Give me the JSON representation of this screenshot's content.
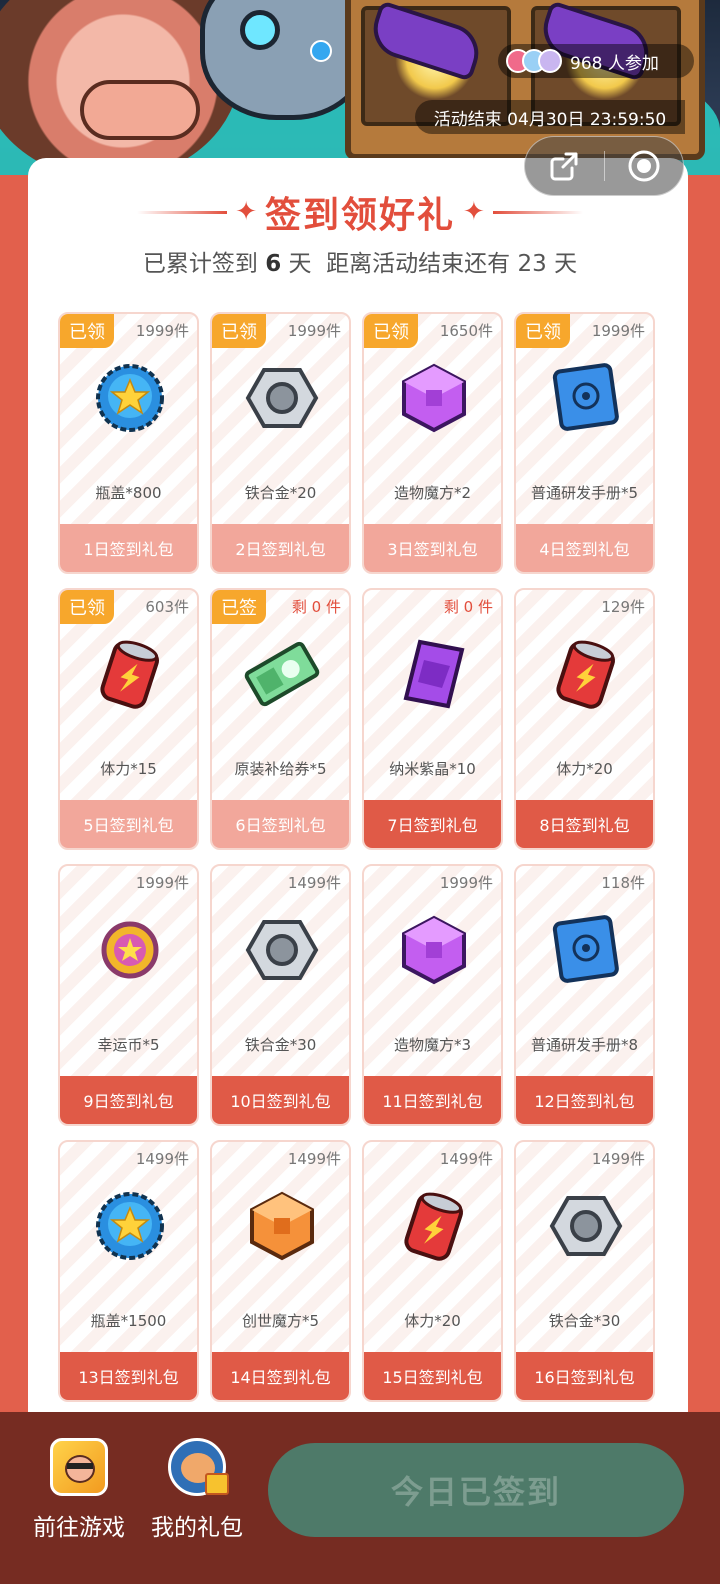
{
  "banner": {
    "participants_text": "968 人参加",
    "deadline_text": "活动结束 04月30日 23:59:50"
  },
  "header": {
    "title": "签到领好礼",
    "summary_prefix": "已累计签到",
    "signed_days": "6",
    "summary_mid": "天  距离活动结束还有",
    "remaining_days": "23",
    "summary_suffix": "天"
  },
  "colors": {
    "accent": "#e24e3c",
    "badge": "#f7a72c",
    "footer_active": "#e05a47",
    "footer_done": "#f2a79b",
    "bottom_bar": "#762c22",
    "sign_button": "#4e7a69"
  },
  "gifts": [
    {
      "badge": "已领",
      "stock": "1999件",
      "name": "瓶盖*800",
      "label": "1日签到礼包",
      "icon": "bottle-cap-icon",
      "done": true
    },
    {
      "badge": "已领",
      "stock": "1999件",
      "name": "铁合金*20",
      "label": "2日签到礼包",
      "icon": "hex-nut-icon",
      "done": true
    },
    {
      "badge": "已领",
      "stock": "1650件",
      "name": "造物魔方*2",
      "label": "3日签到礼包",
      "icon": "purple-cube-icon",
      "done": true
    },
    {
      "badge": "已领",
      "stock": "1999件",
      "name": "普通研发手册*5",
      "label": "4日签到礼包",
      "icon": "blue-book-icon",
      "done": true
    },
    {
      "badge": "已领",
      "stock": "603件",
      "name": "体力*15",
      "label": "5日签到礼包",
      "icon": "energy-can-icon",
      "done": true
    },
    {
      "badge": "已签",
      "stock": "剩 0 件",
      "name": "原装补给券*5",
      "label": "6日签到礼包",
      "icon": "ticket-icon",
      "done": true,
      "stock_red": true
    },
    {
      "badge": "",
      "stock": "剩 0 件",
      "name": "纳米紫晶*10",
      "label": "7日签到礼包",
      "icon": "purple-crystal-icon",
      "done": false,
      "stock_red": true
    },
    {
      "badge": "",
      "stock": "129件",
      "name": "体力*20",
      "label": "8日签到礼包",
      "icon": "energy-can-icon",
      "done": false
    },
    {
      "badge": "",
      "stock": "1999件",
      "name": "幸运币*5",
      "label": "9日签到礼包",
      "icon": "lucky-coin-icon",
      "done": false
    },
    {
      "badge": "",
      "stock": "1499件",
      "name": "铁合金*30",
      "label": "10日签到礼包",
      "icon": "hex-nut-icon",
      "done": false
    },
    {
      "badge": "",
      "stock": "1999件",
      "name": "造物魔方*3",
      "label": "11日签到礼包",
      "icon": "purple-cube-icon",
      "done": false
    },
    {
      "badge": "",
      "stock": "118件",
      "name": "普通研发手册*8",
      "label": "12日签到礼包",
      "icon": "blue-book-icon",
      "done": false
    },
    {
      "badge": "",
      "stock": "1499件",
      "name": "瓶盖*1500",
      "label": "13日签到礼包",
      "icon": "bottle-cap-icon",
      "done": false
    },
    {
      "badge": "",
      "stock": "1499件",
      "name": "创世魔方*5",
      "label": "14日签到礼包",
      "icon": "orange-cube-icon",
      "done": false
    },
    {
      "badge": "",
      "stock": "1499件",
      "name": "体力*20",
      "label": "15日签到礼包",
      "icon": "energy-can-icon",
      "done": false
    },
    {
      "badge": "",
      "stock": "1499件",
      "name": "铁合金*30",
      "label": "16日签到礼包",
      "icon": "hex-nut-icon",
      "done": false
    }
  ],
  "bottom": {
    "go_game": "前往游戏",
    "my_gifts": "我的礼包",
    "sign_button": "今日已签到"
  }
}
